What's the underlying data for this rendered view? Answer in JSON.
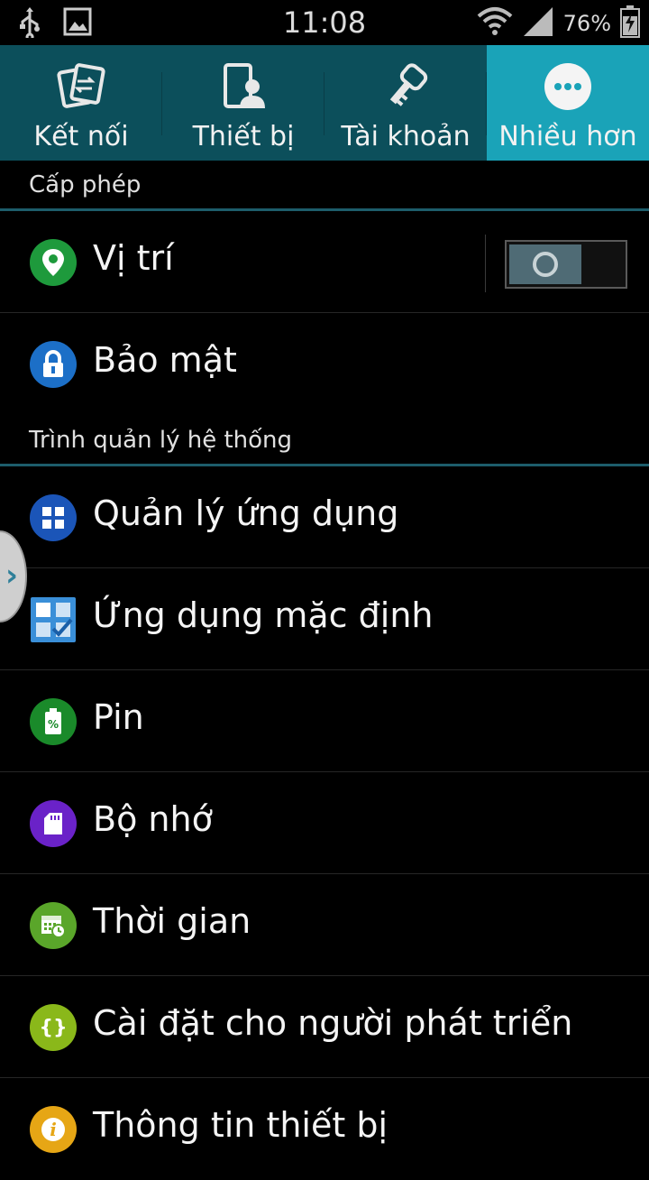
{
  "status_bar": {
    "time": "11:08",
    "battery": "76%",
    "icons": [
      "usb-icon",
      "image-icon",
      "wifi-icon",
      "signal-icon",
      "battery-icon"
    ]
  },
  "tabs": [
    {
      "label": "Kết nối",
      "icon": "connections-icon",
      "active": false
    },
    {
      "label": "Thiết bị",
      "icon": "device-icon",
      "active": false
    },
    {
      "label": "Tài khoản",
      "icon": "accounts-icon",
      "active": false
    },
    {
      "label": "Nhiều hơn",
      "icon": "more-icon",
      "active": true
    }
  ],
  "sections": [
    {
      "title": "Cấp phép",
      "items": [
        {
          "label": "Vị trí",
          "icon": "location-icon",
          "color": "#1e9a3c",
          "toggle": true
        },
        {
          "label": "Bảo mật",
          "icon": "lock-icon",
          "color": "#1c6fc7"
        }
      ]
    },
    {
      "title": "Trình quản lý hệ thống",
      "items": [
        {
          "label": "Quản lý ứng dụng",
          "icon": "apps-grid-icon",
          "color": "#1b55b8"
        },
        {
          "label": "Ứng dụng mặc định",
          "icon": "default-apps-icon",
          "color": "#3a8fd8"
        },
        {
          "label": "Pin",
          "icon": "battery-percent-icon",
          "color": "#1a8a2a"
        },
        {
          "label": "Bộ nhớ",
          "icon": "sd-card-icon",
          "color": "#6a22c8"
        },
        {
          "label": "Thời gian",
          "icon": "calendar-clock-icon",
          "color": "#5aa62a"
        },
        {
          "label": "Cài đặt cho người phát triển",
          "icon": "braces-icon",
          "color": "#8ab81a"
        },
        {
          "label": "Thông tin thiết bị",
          "icon": "info-icon",
          "color": "#e6a615"
        }
      ]
    }
  ]
}
